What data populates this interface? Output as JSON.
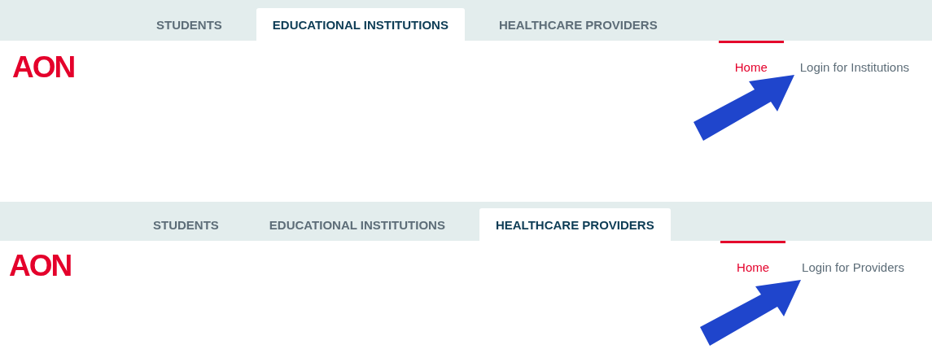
{
  "panels": [
    {
      "tabs": [
        {
          "label": "STUDENTS",
          "selected": false
        },
        {
          "label": "EDUCATIONAL INSTITUTIONS",
          "selected": true
        },
        {
          "label": "HEALTHCARE PROVIDERS",
          "selected": false
        }
      ],
      "logo": "AON",
      "nav": [
        {
          "label": "Home",
          "selected": true
        },
        {
          "label": "Login for Institutions",
          "selected": false
        }
      ]
    },
    {
      "tabs": [
        {
          "label": "STUDENTS",
          "selected": false
        },
        {
          "label": "EDUCATIONAL INSTITUTIONS",
          "selected": false
        },
        {
          "label": "HEALTHCARE PROVIDERS",
          "selected": true
        }
      ],
      "logo": "AON",
      "nav": [
        {
          "label": "Home",
          "selected": true
        },
        {
          "label": "Login for Providers",
          "selected": false
        }
      ]
    }
  ]
}
